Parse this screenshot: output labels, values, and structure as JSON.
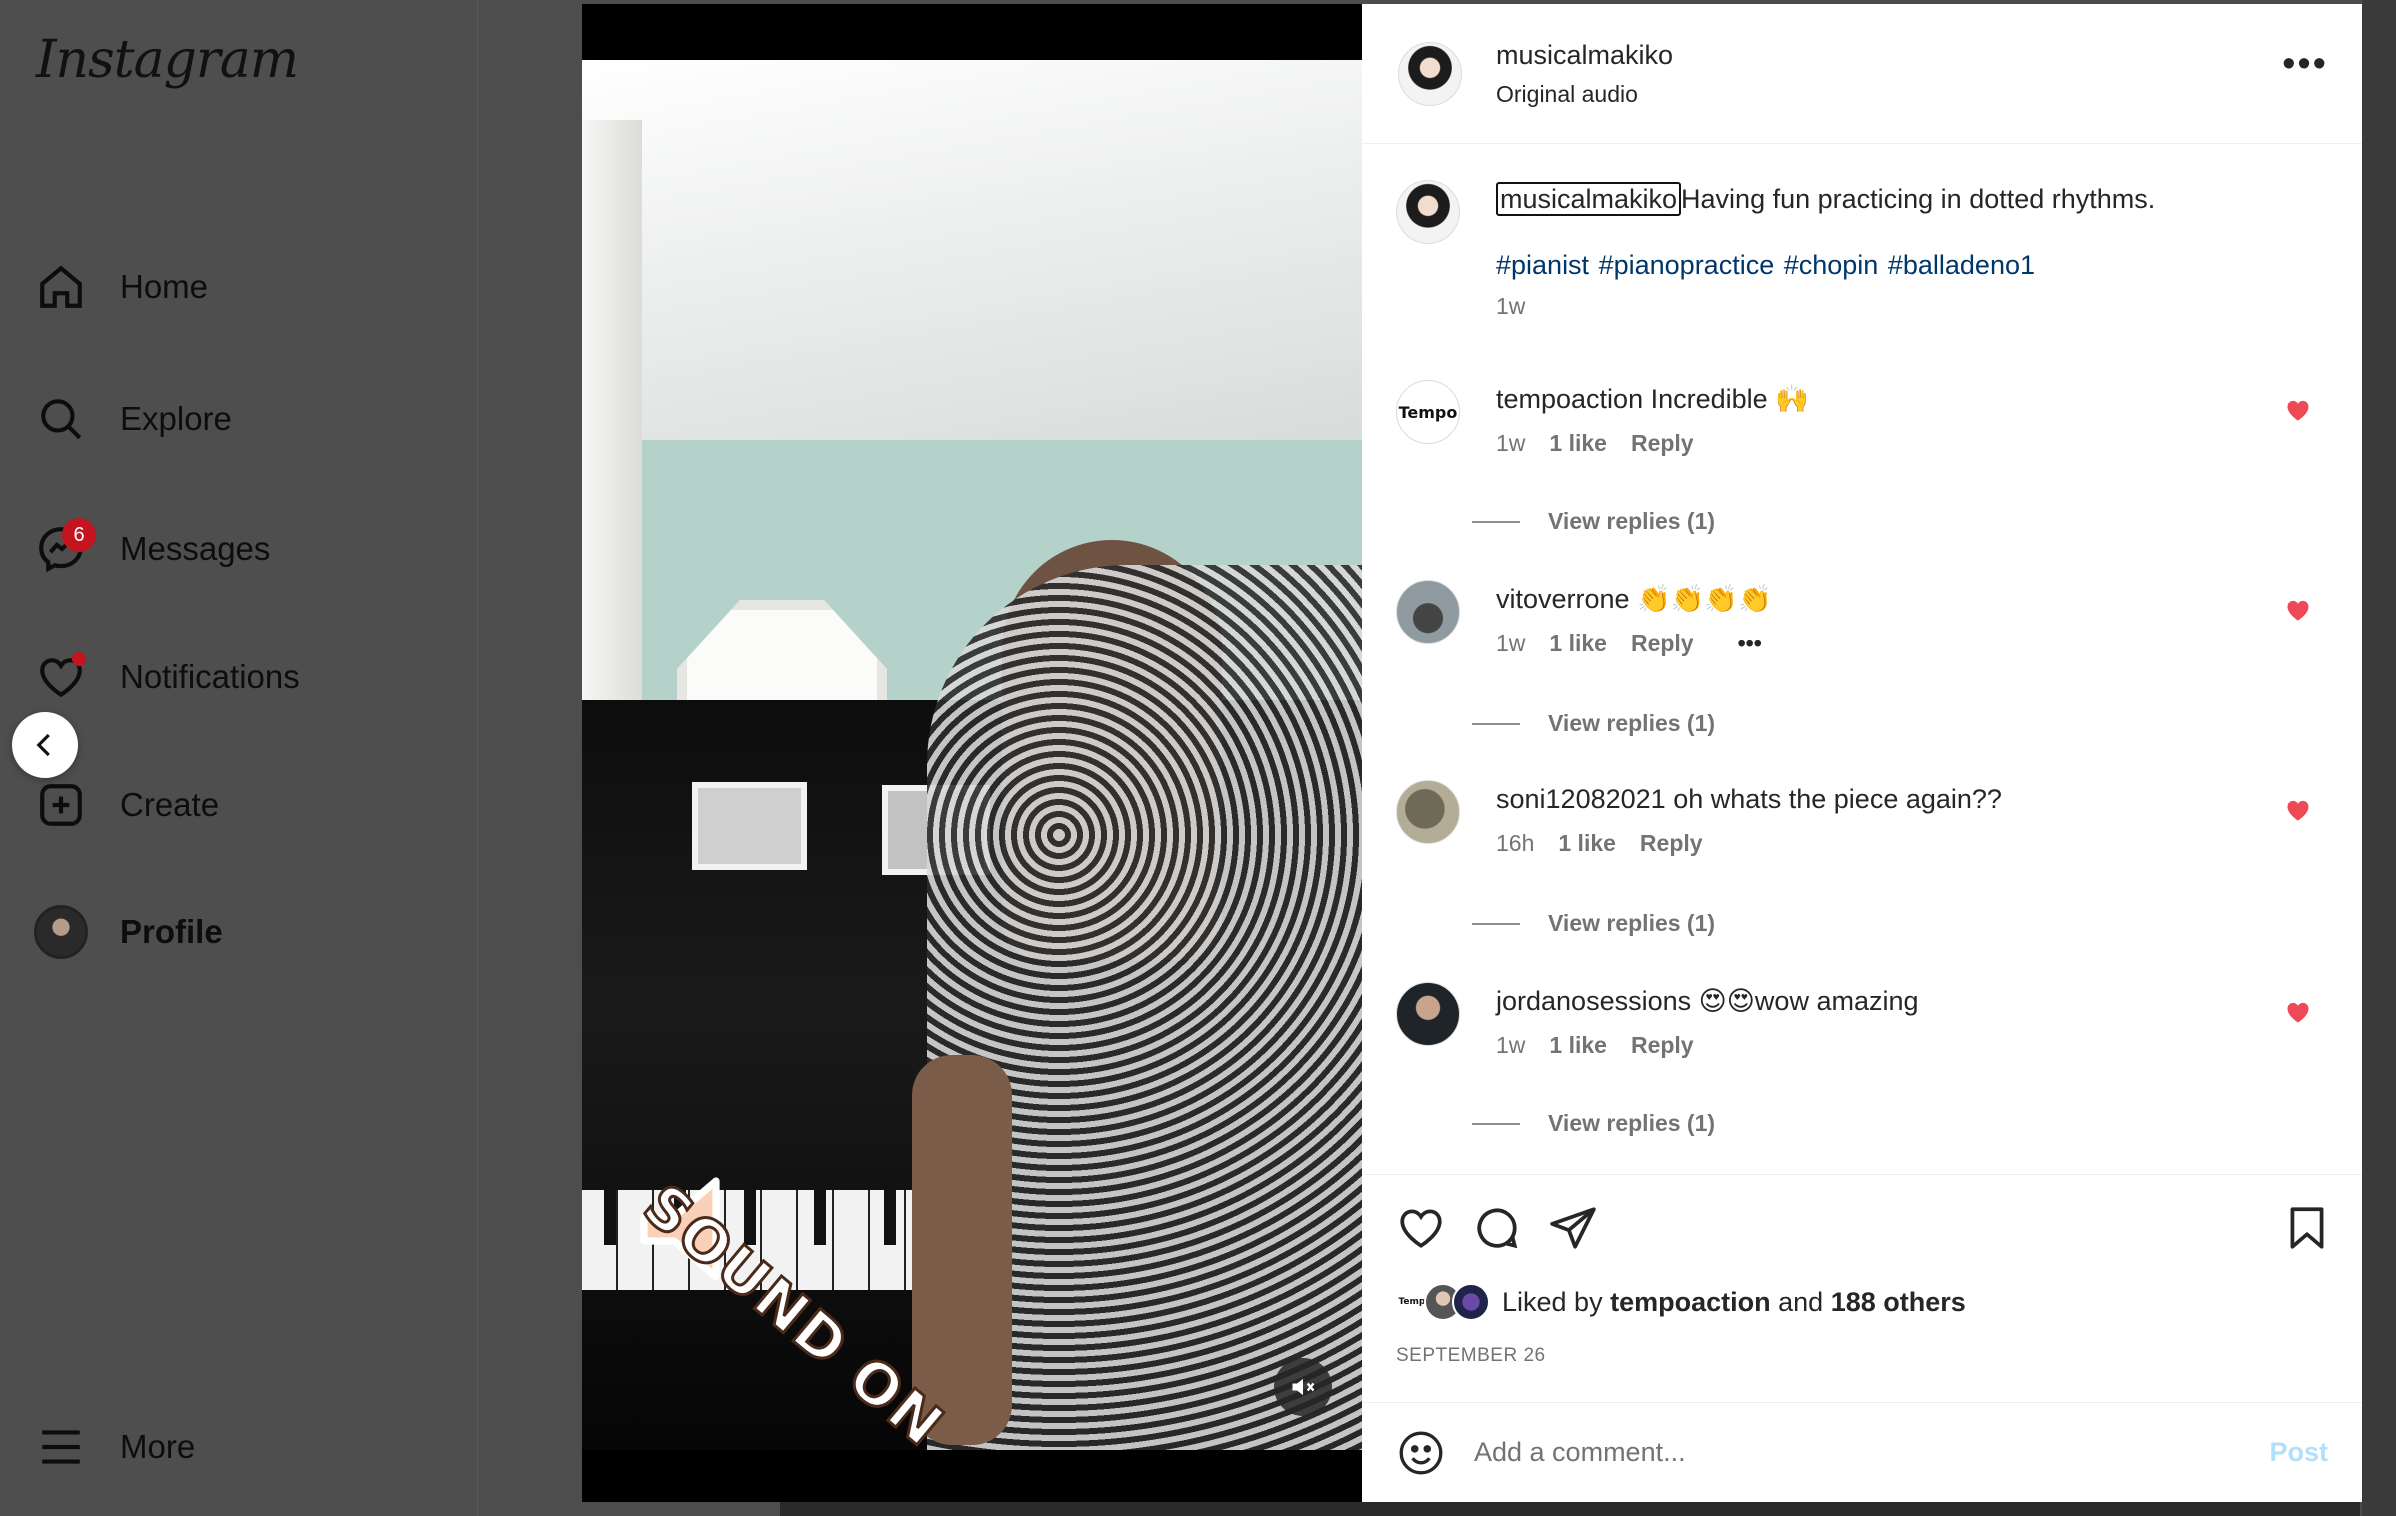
{
  "sidebar": {
    "logo": "Instagram",
    "items": [
      {
        "label": "Home",
        "icon": "home-icon"
      },
      {
        "label": "Explore",
        "icon": "search-icon"
      },
      {
        "label": "Messages",
        "icon": "messenger-icon",
        "badge": "6"
      },
      {
        "label": "Notifications",
        "icon": "heart-icon"
      },
      {
        "label": "Create",
        "icon": "create-icon"
      },
      {
        "label": "Profile",
        "icon": "avatar"
      }
    ],
    "more_label": "More"
  },
  "video": {
    "sticker_text": "SOUND ON",
    "muted": true
  },
  "post": {
    "author": "musicalmakiko",
    "audio": "Original audio",
    "caption": {
      "username": "musicalmakiko",
      "text": "Having fun practicing in dotted rhythms.",
      "hashtags": [
        "#pianist",
        "#pianopractice",
        "#chopin",
        "#balladeno1"
      ],
      "time": "1w"
    },
    "comments": [
      {
        "username": "tempoaction",
        "text": "Incredible 🙌",
        "time": "1w",
        "likes": "1 like",
        "reply": "Reply",
        "view_replies": "View replies (1)",
        "liked": true,
        "avatar_text": "Tempo"
      },
      {
        "username": "vitoverrone",
        "text": "👏👏👏👏",
        "time": "1w",
        "likes": "1 like",
        "reply": "Reply",
        "view_replies": "View replies (1)",
        "liked": true,
        "more": "•••"
      },
      {
        "username": "soni12082021",
        "text": "oh whats the piece again??",
        "time": "16h",
        "likes": "1 like",
        "reply": "Reply",
        "view_replies": "View replies (1)",
        "liked": true
      },
      {
        "username": "jordanosessions",
        "text": "😍😍wow amazing",
        "time": "1w",
        "likes": "1 like",
        "reply": "Reply",
        "view_replies": "View replies (1)",
        "liked": true
      }
    ],
    "likes_prefix": "Liked by",
    "liked_by_user": "tempoaction",
    "likes_and": "and",
    "likes_others": "188 others",
    "like_avatar_text": "Tempo",
    "date": "SEPTEMBER 26",
    "add_comment_placeholder": "Add a comment...",
    "post_button": "Post"
  },
  "colors": {
    "heart": "#ed4956",
    "link": "#00376b",
    "badge": "#c4141f",
    "post_disabled": "#b2dffc"
  }
}
